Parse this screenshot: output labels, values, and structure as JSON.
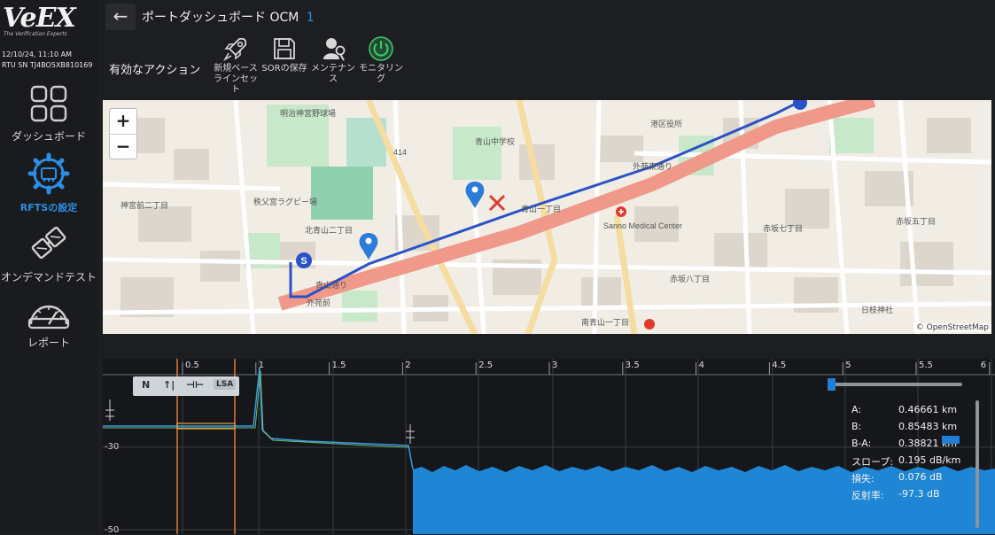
{
  "sidebar": {
    "logo": "VeEX",
    "logo_tagline": "The Verification Experts",
    "datetime": "12/10/24, 11:10 AM",
    "rtu_sn": "RTU SN TJ4BO5XB810169",
    "nav": [
      {
        "label": "ダッシュボード",
        "icon": "dashboard-grid-icon"
      },
      {
        "label": "RFTSの設定",
        "icon": "gear-settings-icon",
        "active": true
      },
      {
        "label": "オンデマンドテスト",
        "icon": "on-demand-test-icon"
      },
      {
        "label": "レポート",
        "icon": "report-gauge-icon"
      }
    ]
  },
  "header": {
    "back_icon": "back-arrow-icon",
    "title": "ポートダッシュボード",
    "title_suffix": "OCM",
    "port_number": "1"
  },
  "actions": {
    "label": "有効なアクション",
    "items": [
      {
        "label": "新規ベースラインセット",
        "icon": "rocket-icon"
      },
      {
        "label": "SORの保存",
        "icon": "floppy-disk-icon"
      },
      {
        "label": "メンテナンス",
        "icon": "maintenance-worker-icon"
      },
      {
        "label": "モニタリング",
        "icon": "power-icon",
        "color": "#3ccf6c"
      }
    ]
  },
  "map": {
    "zoom_in": "+",
    "zoom_out": "−",
    "attribution": "© OpenStreetMap",
    "start_marker": "S",
    "labels": [
      "明治神宮野球場",
      "青山中学校",
      "414",
      "北青山二丁目",
      "青山一丁目",
      "赤坂五丁目",
      "赤坂八丁目",
      "赤坂七丁目",
      "外苑前",
      "青山通り",
      "Sanno Medical Center",
      "秩父宮ラグビー場",
      "神宮前二丁目",
      "南青山一丁目",
      "外苑東通り",
      "港区役所",
      "日枝神社"
    ]
  },
  "trace": {
    "x_ticks": [
      "0.5",
      "1",
      "1.5",
      "2",
      "2.5",
      "3",
      "3.5",
      "4",
      "4.5",
      "5",
      "5.5",
      "6"
    ],
    "y_ticks": [
      "-30",
      "-50"
    ],
    "tools": [
      "N",
      "↑|",
      "⊣⊢",
      "LSA"
    ],
    "readout": [
      {
        "k": "A:",
        "v": "0.46661 km"
      },
      {
        "k": "B:",
        "v": "0.85483 km"
      },
      {
        "k": "B-A:",
        "v": "0.38821 km"
      },
      {
        "k": "スロープ:",
        "v": "0.195 dB/km"
      },
      {
        "k": "損失:",
        "v": "0.076 dB"
      },
      {
        "k": "反射率:",
        "v": "-97.3 dB"
      }
    ]
  }
}
